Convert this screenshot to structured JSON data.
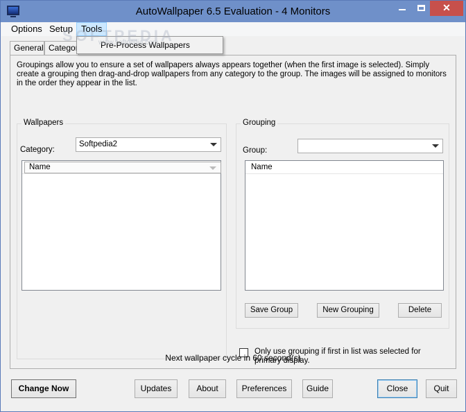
{
  "window": {
    "title": "AutoWallpaper 6.5 Evaluation - 4 Monitors",
    "minimize_label": "",
    "close_glyph": "✕"
  },
  "menubar": {
    "items": [
      {
        "label": "Options"
      },
      {
        "label": "Setup"
      },
      {
        "label": "Tools"
      }
    ],
    "tools_dropdown": [
      {
        "label": "Pre-Process Wallpapers"
      }
    ]
  },
  "tabs": [
    {
      "label": "General"
    },
    {
      "label": "Category"
    }
  ],
  "panel": {
    "description": "Groupings allow you to ensure a set of wallpapers always appears together (when the first image is selected). Simply create a grouping then drag-and-drop wallpapers from any category to the group. The images will be assigned to monitors in the order they appear in the list.",
    "wallpapers": {
      "legend": "Wallpapers",
      "category_label": "Category:",
      "category_value": "Softpedia2",
      "list_header": "Name"
    },
    "grouping": {
      "legend": "Grouping",
      "group_label": "Group:",
      "group_value": "",
      "list_header": "Name",
      "buttons": {
        "save": "Save Group",
        "new": "New Grouping",
        "delete": "Delete"
      }
    },
    "checkbox": {
      "checked": false,
      "label": "Only use grouping if first in list was selected for primary display."
    }
  },
  "status": "Next wallpaper cycle in 60 second(s)",
  "bottom_buttons": {
    "change_now": "Change Now",
    "updates": "Updates",
    "about": "About",
    "preferences": "Preferences",
    "guide": "Guide",
    "close": "Close",
    "quit": "Quit"
  },
  "watermark": {
    "large": "SOFTPEDIA",
    "small": "www.softpedia.com"
  },
  "colors": {
    "titlebar": "#6f90c9",
    "close_button": "#c7504b",
    "menu_highlight": "#cce8ff"
  }
}
